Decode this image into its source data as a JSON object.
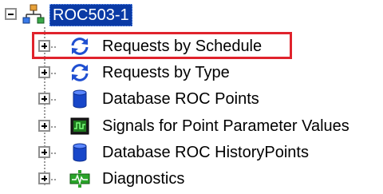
{
  "tree": {
    "root": {
      "label": "ROC503-1",
      "icon": "network-hierarchy-icon",
      "expanded": true,
      "selected": true
    },
    "children": [
      {
        "label": "Requests by Schedule",
        "icon": "refresh-arrows-icon",
        "expanded": false,
        "highlighted": true
      },
      {
        "label": "Requests by Type",
        "icon": "refresh-arrows-icon",
        "expanded": false,
        "highlighted": false
      },
      {
        "label": "Database ROC Points",
        "icon": "database-cylinder-icon",
        "expanded": false,
        "highlighted": false
      },
      {
        "label": "Signals for Point Parameter Values",
        "icon": "signal-monitor-icon",
        "expanded": false,
        "highlighted": false
      },
      {
        "label": "Database ROC HistoryPoints",
        "icon": "database-cylinder-icon",
        "expanded": false,
        "highlighted": false
      },
      {
        "label": "Diagnostics",
        "icon": "diagnostics-network-icon",
        "expanded": false,
        "highlighted": false
      }
    ]
  },
  "colors": {
    "selection": "#0a3aa5",
    "highlight_box": "#e0232c",
    "refresh_icon": "#1f4fd1",
    "database_icon": "#1746c9",
    "diagnostics_icon": "#2aa52a"
  }
}
